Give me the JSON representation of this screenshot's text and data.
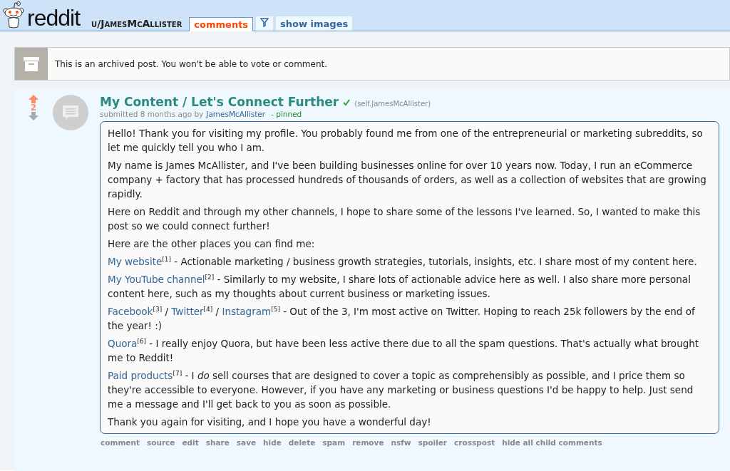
{
  "header": {
    "logo": "reddit",
    "username": "u/JamesMcAllister",
    "tabs": [
      {
        "kind": "text",
        "label": "comments",
        "selected": true
      },
      {
        "kind": "filter",
        "selected": false
      },
      {
        "kind": "text",
        "label": "show images",
        "selected": false
      }
    ]
  },
  "notice": {
    "text": "This is an archived post. You won't be able to vote or comment."
  },
  "post": {
    "score": "2",
    "title": "My Content / Let's Connect Further",
    "domain": "(self.JamesMcAllister)",
    "submitted": "submitted 8 months ago by",
    "author": "JamesMcAllister",
    "flag": "- pinned",
    "paragraphs": [
      [
        {
          "kind": "text",
          "text": "Hello! Thank you for visiting my profile. You probably found me from one of the entrepreneurial or marketing subreddits, so let me quickly tell you who I am."
        }
      ],
      [
        {
          "kind": "text",
          "text": "My name is James McAllister, and I've been building businesses online for over 10 years now. Today, I run an eCommerce company + factory that has processed hundreds of thousands of orders, as well as a collection of websites that are growing rapidly."
        }
      ],
      [
        {
          "kind": "text",
          "text": "Here on Reddit and through my other channels, I hope to share some of the lessons I've learned. So, I wanted to make this post so we could connect further!"
        }
      ],
      [
        {
          "kind": "text",
          "text": "Here are the other places you can find me:"
        }
      ],
      [
        {
          "kind": "link",
          "text": "My website",
          "ref": "[1]"
        },
        {
          "kind": "text",
          "text": " - Actionable marketing / business growth strategies, tutorials, insights, etc. I share most of my content here."
        }
      ],
      [
        {
          "kind": "link",
          "text": "My YouTube channel",
          "ref": "[2]"
        },
        {
          "kind": "text",
          "text": " - Similarly to my website, I share lots of actionable advice here as well. I also share more personal content here, such as my thoughts about current business or marketing issues."
        }
      ],
      [
        {
          "kind": "link",
          "text": "Facebook",
          "ref": "[3]"
        },
        {
          "kind": "text",
          "text": " / "
        },
        {
          "kind": "link",
          "text": "Twitter",
          "ref": "[4]"
        },
        {
          "kind": "text",
          "text": " / "
        },
        {
          "kind": "link",
          "text": "Instagram",
          "ref": "[5]"
        },
        {
          "kind": "text",
          "text": " - Out of the 3, I'm most active on Twitter. Hoping to reach 25k followers by the end of the year! :)"
        }
      ],
      [
        {
          "kind": "link",
          "text": "Quora",
          "ref": "[6]"
        },
        {
          "kind": "text",
          "text": " - I really enjoy Quora, but have been less active there due to all the spam questions. That's actually what brought me to Reddit!"
        }
      ],
      [
        {
          "kind": "link",
          "text": "Paid products",
          "ref": "[7]"
        },
        {
          "kind": "text",
          "text": " - I *do* sell courses that are designed to cover a topic as comprehensibly as possible, and I price them so they're accessible to everyone. However, if you have any marketing or business questions I'd be happy to help. Just send me a message and I'll get back to you as soon as possible."
        }
      ],
      [
        {
          "kind": "text",
          "text": "Thank you again for visiting, and I hope you have a wonderful day!"
        }
      ]
    ],
    "actions": [
      "comment",
      "source",
      "edit",
      "share",
      "save",
      "hide",
      "delete",
      "spam",
      "remove",
      "nsfw",
      "spoiler",
      "crosspost",
      "hide all child comments"
    ]
  }
}
